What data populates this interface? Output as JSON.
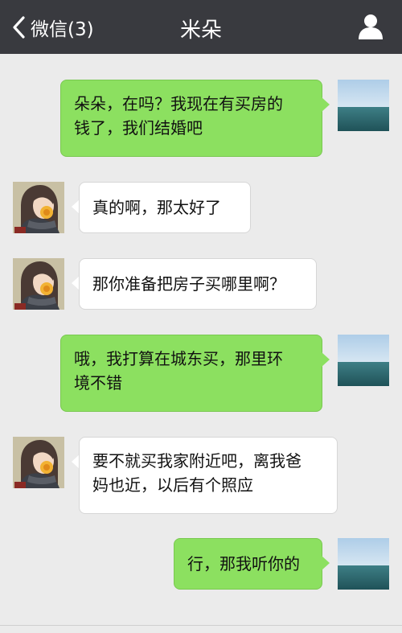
{
  "header": {
    "back_label": "微信(3)",
    "title": "米朵"
  },
  "colors": {
    "header_bg": "#393a3f",
    "chat_bg": "#ebebeb",
    "outgoing_bubble": "#8ce060",
    "incoming_bubble": "#ffffff"
  },
  "messages": [
    {
      "direction": "outgoing",
      "lines": [
        "朵朵，在吗？我现在有买房的",
        "钱了，我们结婚吧"
      ]
    },
    {
      "direction": "incoming",
      "lines": [
        "真的啊，那太好了"
      ]
    },
    {
      "direction": "incoming",
      "lines": [
        "那你准备把房子买哪里啊？"
      ]
    },
    {
      "direction": "outgoing",
      "lines": [
        "哦，我打算在城东买，那里环",
        "境不错"
      ]
    },
    {
      "direction": "incoming",
      "lines": [
        "要不就买我家附近吧，离我爸",
        "妈也近，以后有个照应"
      ]
    },
    {
      "direction": "outgoing",
      "lines": [
        "行，那我听你的"
      ]
    }
  ]
}
